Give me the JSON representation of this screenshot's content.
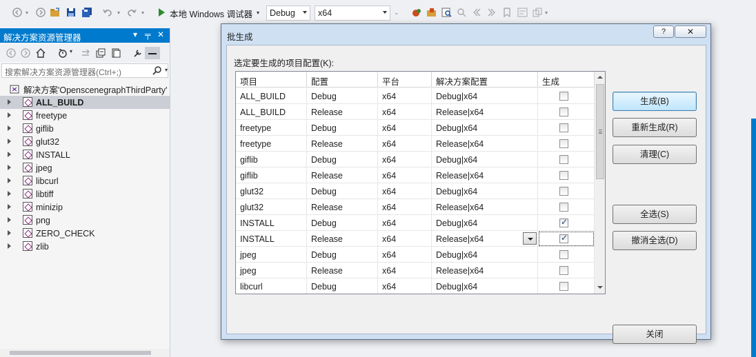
{
  "toolbar": {
    "run_label": "本地 Windows 调试器",
    "config_value": "Debug",
    "platform_value": "x64"
  },
  "solution_explorer": {
    "title": "解决方案资源管理器",
    "title_controls": [
      "▾",
      "╤",
      "✕"
    ],
    "search_placeholder": "搜索解决方案资源管理器(Ctrl+;)",
    "root_label": "解决方案'OpenscenegraphThirdParty'",
    "projects": [
      "ALL_BUILD",
      "freetype",
      "giflib",
      "glut32",
      "INSTALL",
      "jpeg",
      "libcurl",
      "libtiff",
      "minizip",
      "png",
      "ZERO_CHECK",
      "zlib"
    ],
    "selected_project": "ALL_BUILD"
  },
  "dialog": {
    "title": "批生成",
    "help_label": "?",
    "close_label": "✕",
    "prompt": "选定要生成的项目配置(K):",
    "columns": [
      "项目",
      "配置",
      "平台",
      "解决方案配置",
      "生成"
    ],
    "rows": [
      {
        "project": "ALL_BUILD",
        "config": "Debug",
        "platform": "x64",
        "solution_config": "Debug|x64",
        "build": false
      },
      {
        "project": "ALL_BUILD",
        "config": "Release",
        "platform": "x64",
        "solution_config": "Release|x64",
        "build": false
      },
      {
        "project": "freetype",
        "config": "Debug",
        "platform": "x64",
        "solution_config": "Debug|x64",
        "build": false
      },
      {
        "project": "freetype",
        "config": "Release",
        "platform": "x64",
        "solution_config": "Release|x64",
        "build": false
      },
      {
        "project": "giflib",
        "config": "Debug",
        "platform": "x64",
        "solution_config": "Debug|x64",
        "build": false
      },
      {
        "project": "giflib",
        "config": "Release",
        "platform": "x64",
        "solution_config": "Release|x64",
        "build": false
      },
      {
        "project": "glut32",
        "config": "Debug",
        "platform": "x64",
        "solution_config": "Debug|x64",
        "build": false
      },
      {
        "project": "glut32",
        "config": "Release",
        "platform": "x64",
        "solution_config": "Release|x64",
        "build": false
      },
      {
        "project": "INSTALL",
        "config": "Debug",
        "platform": "x64",
        "solution_config": "Debug|x64",
        "build": true
      },
      {
        "project": "INSTALL",
        "config": "Release",
        "platform": "x64",
        "solution_config": "Release|x64",
        "build": true
      },
      {
        "project": "jpeg",
        "config": "Debug",
        "platform": "x64",
        "solution_config": "Debug|x64",
        "build": false
      },
      {
        "project": "jpeg",
        "config": "Release",
        "platform": "x64",
        "solution_config": "Release|x64",
        "build": false
      },
      {
        "project": "libcurl",
        "config": "Debug",
        "platform": "x64",
        "solution_config": "Debug|x64",
        "build": false
      }
    ],
    "buttons": {
      "build": "生成(B)",
      "rebuild": "重新生成(R)",
      "clean": "清理(C)",
      "select_all": "全选(S)",
      "deselect_all": "撤消全选(D)",
      "close": "关闭"
    }
  }
}
